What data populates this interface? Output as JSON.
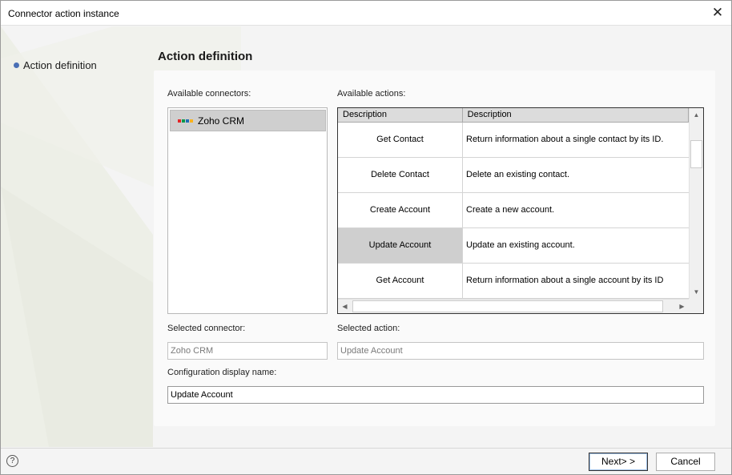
{
  "window": {
    "title": "Connector action instance"
  },
  "nav": {
    "items": [
      {
        "label": "Action definition"
      }
    ]
  },
  "section": {
    "title": "Action definition"
  },
  "connectors": {
    "label": "Available connectors:",
    "items": [
      {
        "label": "Zoho CRM",
        "icon": "zoho-logo-icon"
      }
    ],
    "selected_index": 0
  },
  "actions": {
    "label": "Available actions:",
    "columns": [
      "Description",
      "Description"
    ],
    "rows": [
      {
        "name": "Get Contact",
        "description": "Return information about a single contact by its ID."
      },
      {
        "name": "Delete Contact",
        "description": "Delete an existing contact."
      },
      {
        "name": "Create Account",
        "description": "Create a new account."
      },
      {
        "name": "Update Account",
        "description": "Update an existing account."
      },
      {
        "name": "Get Account",
        "description": "Return information about a single account by its ID"
      }
    ],
    "selected_index": 3
  },
  "selected_connector": {
    "label": "Selected connector:",
    "value": "Zoho CRM"
  },
  "selected_action": {
    "label": "Selected action:",
    "value": "Update Account"
  },
  "display_name": {
    "label": "Configuration display name:",
    "value": "Update Account"
  },
  "footer": {
    "help": "?",
    "next_label": "Next> >",
    "cancel_label": "Cancel"
  },
  "colors": {
    "zoho": [
      "#e42527",
      "#089949",
      "#226db4",
      "#f9b21d"
    ]
  }
}
